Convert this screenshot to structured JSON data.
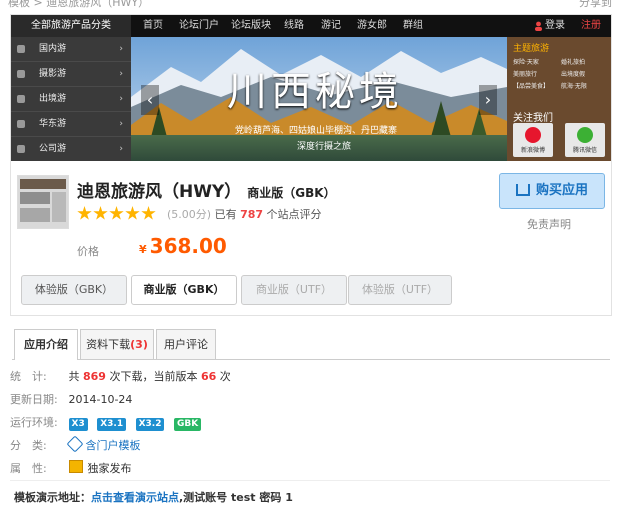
{
  "top": {
    "left_crumb": "模板 > 迪恩旅游风（HWY）",
    "right_text": "分享到"
  },
  "nav": {
    "category_label": "全部旅游产品分类",
    "items": [
      "首页",
      "论坛门户",
      "论坛版块",
      "线路",
      "游记",
      "游女郎",
      "群组"
    ],
    "login": "登录",
    "register": "注册"
  },
  "sidebar": {
    "items": [
      "国内游",
      "摄影游",
      "出境游",
      "华东游",
      "公司游"
    ]
  },
  "hero": {
    "title": "川西秘境",
    "line1": "党岭葫芦海、四姑娘山毕棚沟、丹巴藏寨",
    "line2": "深度行摄之旅"
  },
  "right_panel": {
    "title": "主题旅游",
    "tags": [
      "探险·天家",
      "婚礼旅拍",
      "美丽旅行",
      "出境度假",
      "【品尝美食】",
      "航海·无限"
    ],
    "follow": "关注我们",
    "socials": [
      "新浪微博",
      "腾讯微信"
    ]
  },
  "product": {
    "name": "迪恩旅游风（HWY）",
    "edition": "商业版（GBK）",
    "rating_score": "(5.00分)",
    "rating_prefix": "已有",
    "rating_count": "787",
    "rating_suffix": "个站点评分",
    "stars": 5,
    "price_label": "价格",
    "currency": "¥",
    "price": "368.00",
    "buy_label": "购买应用",
    "disclaimer": "免责声明"
  },
  "versions": [
    "体验版（GBK）",
    "商业版（GBK）",
    "商业版（UTF）",
    "体验版（UTF）"
  ],
  "tabs": {
    "intro": "应用介绍",
    "download": "资料下载",
    "download_count": "(3)",
    "reviews": "用户评论"
  },
  "info": {
    "stats_label": "统　计:",
    "stats_prefix": "共",
    "downloads": "869",
    "stats_mid": "次下载，当前版本",
    "version_downloads": "66",
    "stats_suffix": "次",
    "updated_label": "更新日期:",
    "updated": "2014-10-24",
    "env_label": "运行环境:",
    "env_tags": [
      "X3",
      "X3.1",
      "X3.2",
      "GBK"
    ],
    "category_label": "分　类:",
    "category": "含门户模板",
    "attr_label": "属　性:",
    "attr": "独家发布"
  },
  "demo": {
    "label": "模板演示地址：",
    "link": "点击查看演示站点",
    "rest": ",测试账号 test 密码 1"
  },
  "colors": {
    "accent": "#ff5a00",
    "link": "#1a73c1",
    "red": "#e33333",
    "tag_blue": "#1e8fd0",
    "tag_green": "#29b765"
  }
}
